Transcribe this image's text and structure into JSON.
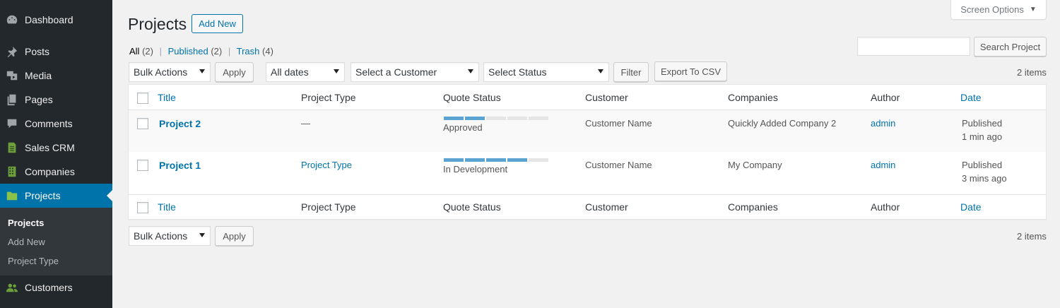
{
  "sidebar": {
    "items": [
      {
        "label": "Dashboard",
        "icon": "dashboard-icon"
      },
      {
        "label": "Posts",
        "icon": "pin-icon"
      },
      {
        "label": "Media",
        "icon": "media-icon"
      },
      {
        "label": "Pages",
        "icon": "pages-icon"
      },
      {
        "label": "Comments",
        "icon": "comment-icon"
      },
      {
        "label": "Sales CRM",
        "icon": "document-icon"
      },
      {
        "label": "Companies",
        "icon": "building-icon"
      },
      {
        "label": "Projects",
        "icon": "folder-icon"
      },
      {
        "label": "Customers",
        "icon": "users-icon"
      }
    ],
    "submenu": [
      "Projects",
      "Add New",
      "Project Type"
    ]
  },
  "header": {
    "title": "Projects",
    "add_new": "Add New",
    "screen_options": "Screen Options"
  },
  "views": {
    "all": "All",
    "all_count": "(2)",
    "published": "Published",
    "published_count": "(2)",
    "trash": "Trash",
    "trash_count": "(4)"
  },
  "search": {
    "button": "Search Project",
    "value": ""
  },
  "filters": {
    "bulk_actions": "Bulk Actions",
    "apply": "Apply",
    "dates": "All dates",
    "customer": "Select a Customer",
    "status": "Select Status",
    "filter": "Filter",
    "export": "Export To CSV"
  },
  "items_count": "2 items",
  "table": {
    "columns": [
      "Title",
      "Project Type",
      "Quote Status",
      "Customer",
      "Companies",
      "Author",
      "Date"
    ],
    "rows": [
      {
        "title": "Project 2",
        "type": "—",
        "status": "Approved",
        "progress": 2,
        "customer": "Customer Name",
        "company": "Quickly Added Company 2",
        "author": "admin",
        "date_status": "Published",
        "date": "1 min ago"
      },
      {
        "title": "Project 1",
        "type": "Project Type",
        "status": "In Development",
        "progress": 4,
        "customer": "Customer Name",
        "company": "My Company",
        "author": "admin",
        "date_status": "Published",
        "date": "3 mins ago"
      }
    ],
    "progress_total": 5
  },
  "colors": {
    "accent": "#0073aa",
    "sidebar": "#23282d",
    "progress": "#5ba4d2"
  }
}
